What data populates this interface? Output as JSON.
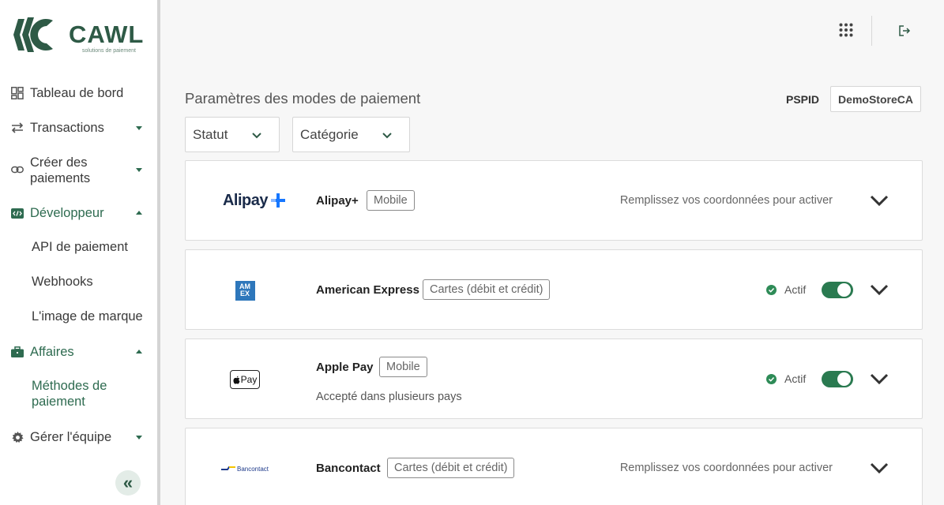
{
  "brand": {
    "name": "CAWL",
    "tagline": "solutions de paiement",
    "accent": "#2e6b50"
  },
  "sidebar": {
    "items": [
      {
        "label": "Tableau de bord",
        "icon": "dashboard-icon"
      },
      {
        "label": "Transactions",
        "icon": "transfer-arrows-icon",
        "expandable": true
      },
      {
        "label": "Créer des paiements",
        "icon": "link-icon",
        "expandable": true
      },
      {
        "label": "Développeur",
        "icon": "code-icon",
        "expanded": true
      },
      {
        "label": "Affaires",
        "icon": "briefcase-icon",
        "expanded": true
      },
      {
        "label": "Gérer l'équipe",
        "icon": "gear-icon",
        "expandable": true
      }
    ],
    "developer_sub": [
      "API de paiement",
      "Webhooks",
      "L'image de marque"
    ],
    "business_sub": [
      "Méthodes de paiement"
    ],
    "collapse_label": "«"
  },
  "header": {
    "apps_icon": "grid-icon",
    "logout_icon": "logout-icon"
  },
  "main": {
    "title": "Paramètres des modes de paiement",
    "pspid_label": "PSPID",
    "pspid_value": "DemoStoreCA",
    "filters": [
      {
        "label": "Statut"
      },
      {
        "label": "Catégorie"
      }
    ],
    "methods": [
      {
        "name": "Alipay+",
        "tag": "Mobile",
        "logo_text": "Alipay",
        "hint": "Remplissez vos coordonnées pour activer"
      },
      {
        "name": "American Express",
        "tag": "Cartes (débit et crédit)",
        "logo_text": "AM EX",
        "status": "Actif",
        "enabled": true
      },
      {
        "name": "Apple Pay",
        "tag": "Mobile",
        "logo_text": "Pay",
        "subtitle": "Accepté dans plusieurs pays",
        "status": "Actif",
        "enabled": true
      },
      {
        "name": "Bancontact",
        "tag": "Cartes (débit et crédit)",
        "logo_text": "Bancontact",
        "hint": "Remplissez vos coordonnées pour activer"
      }
    ]
  }
}
